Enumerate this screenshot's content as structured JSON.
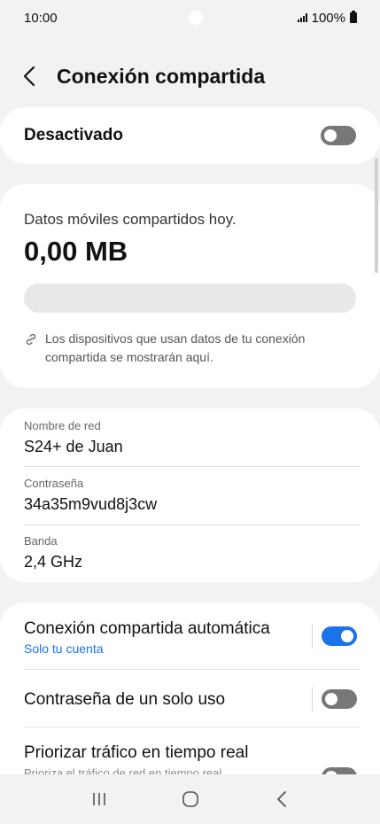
{
  "status_bar": {
    "time": "10:00",
    "battery": "100%"
  },
  "header": {
    "title": "Conexión compartida"
  },
  "master_switch": {
    "label": "Desactivado",
    "enabled": false
  },
  "usage": {
    "label": "Datos móviles compartidos hoy.",
    "value": "0,00 MB",
    "progress_fraction": 0,
    "info": "Los dispositivos que usan datos de tu conexión compartida se mostrarán aquí."
  },
  "network": {
    "name_label": "Nombre de red",
    "name_value": "S24+ de Juan",
    "password_label": "Contraseña",
    "password_value": "34a35m9vud8j3cw",
    "band_label": "Banda",
    "band_value": "2,4 GHz"
  },
  "settings": [
    {
      "title": "Conexión compartida automática",
      "subtitle": "Solo tu cuenta",
      "enabled": true
    },
    {
      "title": "Contraseña de un solo uso",
      "enabled": false
    },
    {
      "title": "Priorizar tráfico en tiempo real",
      "subtitle": "Prioriza el tráfico de red en tiempo real",
      "enabled": false
    }
  ],
  "icons": {
    "back": "chevron-left-icon",
    "link": "link-icon",
    "recents": "recents-icon",
    "home": "home-icon",
    "nav_back": "back-icon"
  },
  "colors": {
    "accent": "#1a73e8",
    "background": "#f2f2f4",
    "card": "#ffffff"
  }
}
